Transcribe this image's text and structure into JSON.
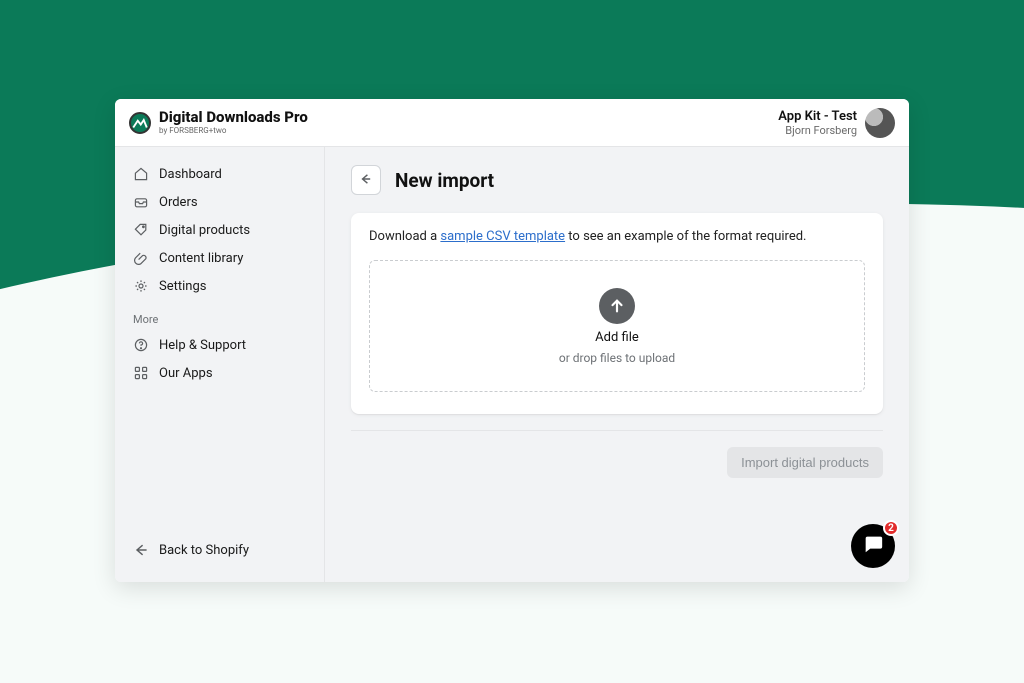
{
  "brand": {
    "title": "Digital Downloads Pro",
    "subtitle": "by FORSBERG+two"
  },
  "user": {
    "account": "App Kit - Test",
    "name": "Bjorn Forsberg"
  },
  "sidebar": {
    "items": [
      {
        "label": "Dashboard"
      },
      {
        "label": "Orders"
      },
      {
        "label": "Digital products"
      },
      {
        "label": "Content library"
      },
      {
        "label": "Settings"
      }
    ],
    "more_label": "More",
    "more_items": [
      {
        "label": "Help & Support"
      },
      {
        "label": "Our Apps"
      }
    ],
    "back_label": "Back to Shopify"
  },
  "page": {
    "title": "New import"
  },
  "card": {
    "text_pre": "Download a ",
    "link_text": "sample CSV template",
    "text_post": " to see an example of the format required.",
    "dropzone_line1": "Add file",
    "dropzone_line2": "or drop files to upload"
  },
  "actions": {
    "import_label": "Import digital products"
  },
  "chat": {
    "badge_count": "2"
  }
}
